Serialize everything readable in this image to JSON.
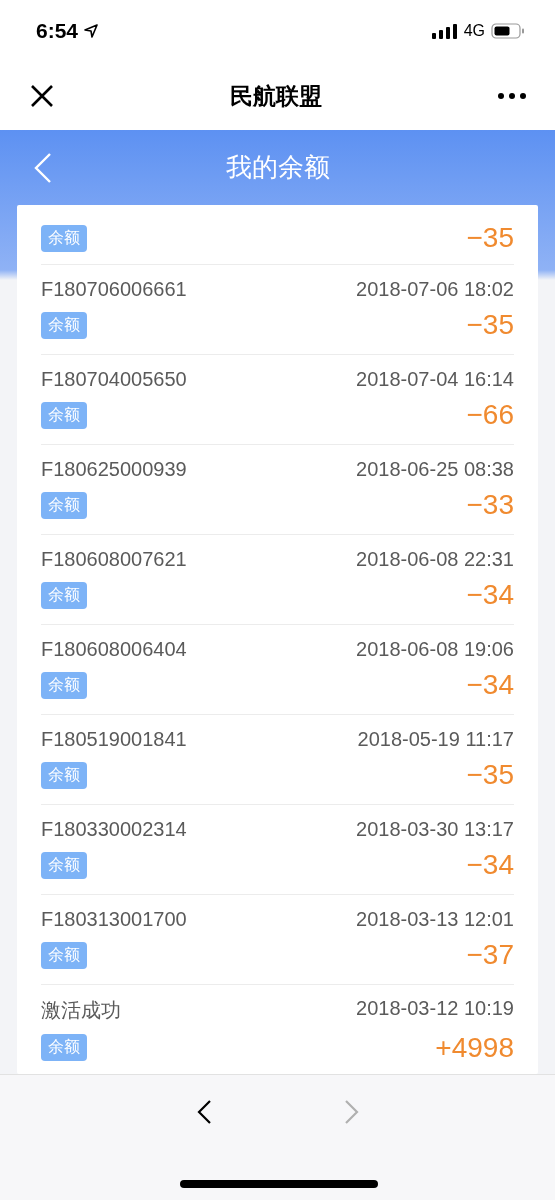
{
  "status_bar": {
    "time": "6:54",
    "network": "4G"
  },
  "nav": {
    "title": "民航联盟"
  },
  "header": {
    "title": "我的余额"
  },
  "rows": [
    {
      "tag": "余额",
      "amount": "−35"
    },
    {
      "order": "F180706006661",
      "date": "2018-07-06 18:02",
      "tag": "余额",
      "amount": "−35"
    },
    {
      "order": "F180704005650",
      "date": "2018-07-04 16:14",
      "tag": "余额",
      "amount": "−66"
    },
    {
      "order": "F180625000939",
      "date": "2018-06-25 08:38",
      "tag": "余额",
      "amount": "−33"
    },
    {
      "order": "F180608007621",
      "date": "2018-06-08 22:31",
      "tag": "余额",
      "amount": "−34"
    },
    {
      "order": "F180608006404",
      "date": "2018-06-08 19:06",
      "tag": "余额",
      "amount": "−34"
    },
    {
      "order": "F180519001841",
      "date": "2018-05-19 11:17",
      "tag": "余额",
      "amount": "−35"
    },
    {
      "order": "F180330002314",
      "date": "2018-03-30 13:17",
      "tag": "余额",
      "amount": "−34"
    },
    {
      "order": "F180313001700",
      "date": "2018-03-13 12:01",
      "tag": "余额",
      "amount": "−37"
    },
    {
      "order": "激活成功",
      "date": "2018-03-12 10:19",
      "tag": "余额",
      "amount": "+4998"
    }
  ],
  "toolbar": {
    "back_disabled": false,
    "forward_disabled": true
  }
}
